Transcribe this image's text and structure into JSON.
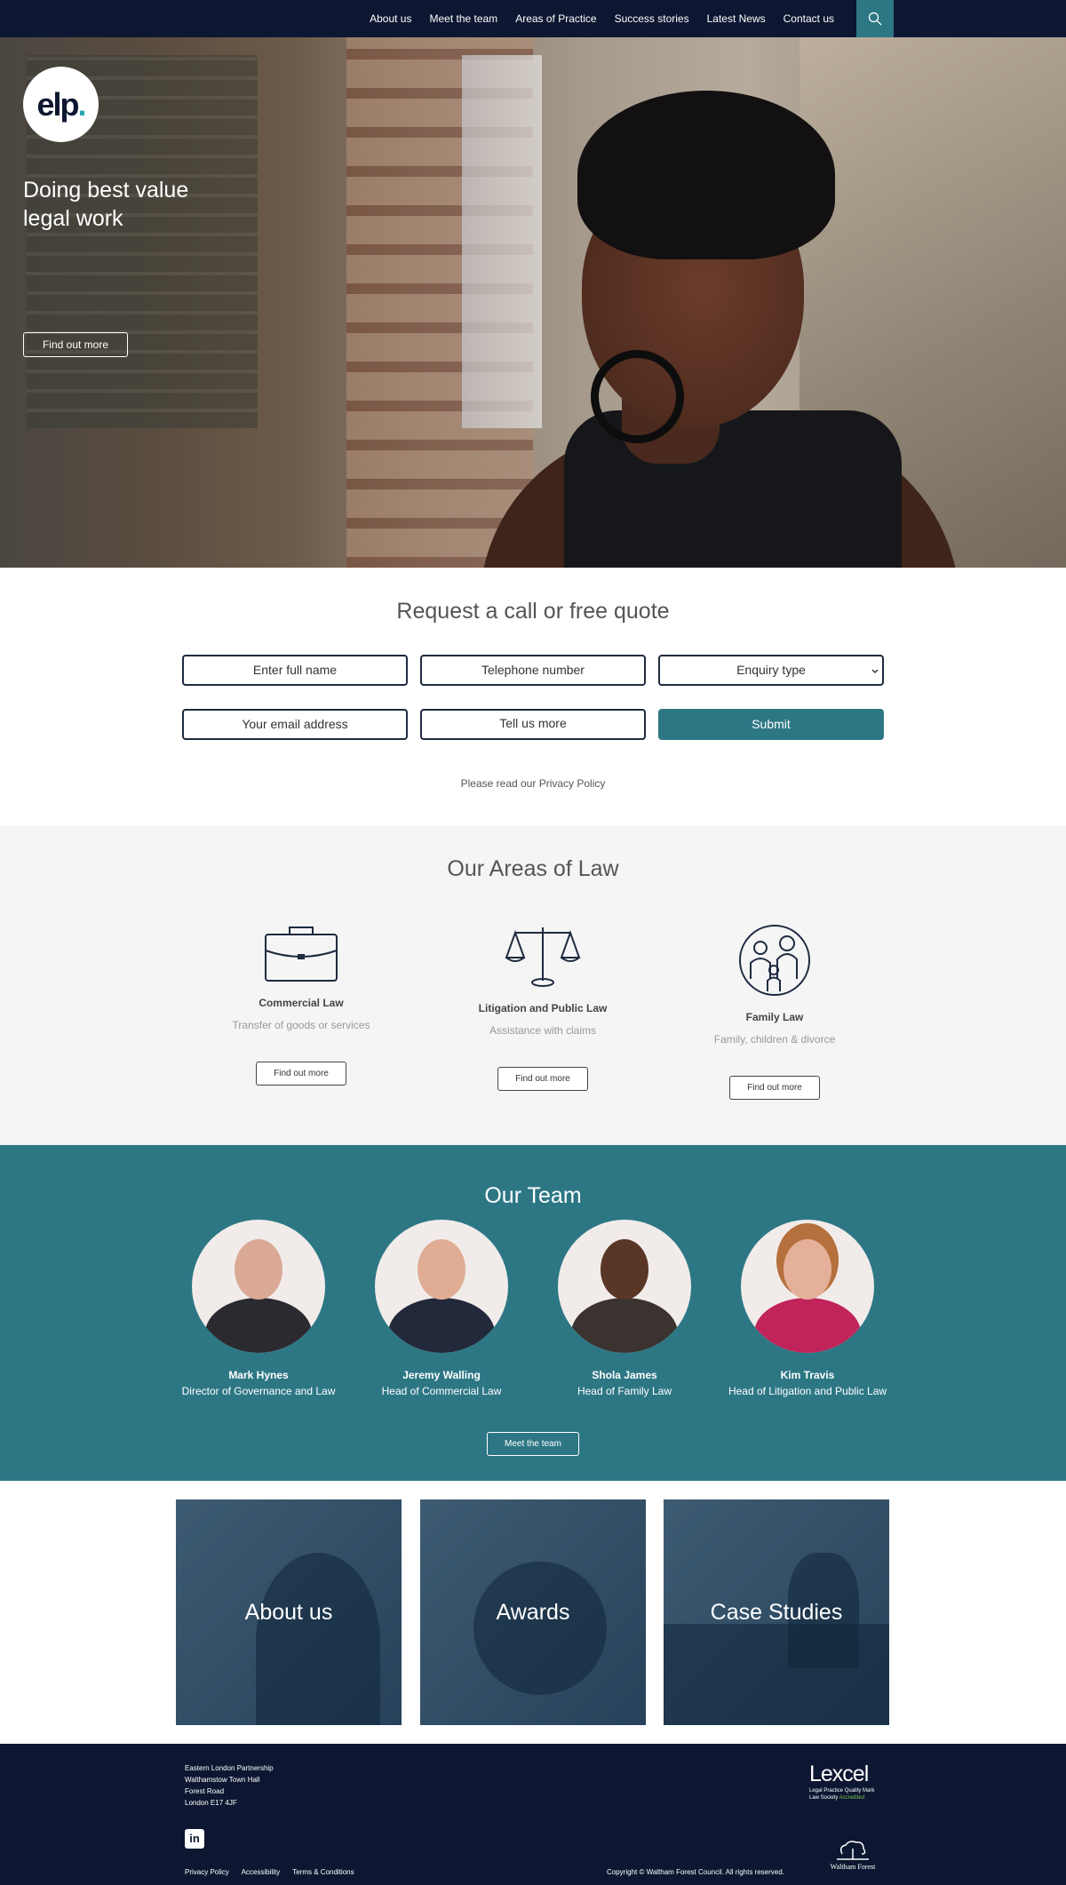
{
  "nav": {
    "items": [
      "About us",
      "Meet the team",
      "Areas of Practice",
      "Success stories",
      "Latest News",
      "Contact us"
    ],
    "search_icon": "search-icon"
  },
  "hero": {
    "logo_text": "elp",
    "logo_dot": ".",
    "tagline": "Doing best value legal work",
    "button": "Find out more"
  },
  "quote_form": {
    "title": "Request a call or free quote",
    "full_name": "Enter full name",
    "telephone": "Telephone number",
    "enquiry": "Enquiry type",
    "email": "Your email address",
    "message": "Tell us more",
    "submit": "Submit",
    "privacy_prefix": "Please read our ",
    "privacy_link": "Privacy Policy"
  },
  "areas": {
    "title": "Our Areas of Law",
    "items": [
      {
        "title": "Commercial Law",
        "subtitle": "Transfer of goods or services",
        "button": "Find out more",
        "icon": "briefcase-icon"
      },
      {
        "title": "Litigation and Public Law",
        "subtitle": "Assistance with claims",
        "button": "Find out more",
        "icon": "scales-icon"
      },
      {
        "title": "Family Law",
        "subtitle": "Family, children & divorce",
        "button": "Find out more",
        "icon": "family-icon"
      }
    ]
  },
  "team": {
    "title": "Our Team",
    "members": [
      {
        "name": "Mark Hynes",
        "role": "Director of Governance and Law"
      },
      {
        "name": "Jeremy Walling",
        "role": "Head of Commercial Law"
      },
      {
        "name": "Shola James",
        "role": "Head of Family Law"
      },
      {
        "name": "Kim Travis",
        "role": "Head of Litigation and Public Law"
      }
    ],
    "button": "Meet the team"
  },
  "tiles": [
    "About us",
    "Awards",
    "Case Studies"
  ],
  "footer": {
    "address": [
      "Eastern London Partnership",
      "Walthamstow Town Hall",
      "Forest Road",
      "London E17 4JF"
    ],
    "links": [
      "Privacy Policy",
      "Accessibility",
      "Terms & Conditions"
    ],
    "copyright": "Copyright © Waltham Forest Council. All rights reserved.",
    "lexcel": {
      "name": "Lexcel",
      "line1": "Legal Practice Quality Mark",
      "line2a": "Law Society ",
      "line2b": "Accredited"
    },
    "council": "Waltham Forest",
    "social_icon": "linkedin-icon",
    "social_text": "in"
  },
  "colors": {
    "navy": "#0d1731",
    "teal": "#2d7785",
    "light_bg": "#f5f5f5"
  }
}
